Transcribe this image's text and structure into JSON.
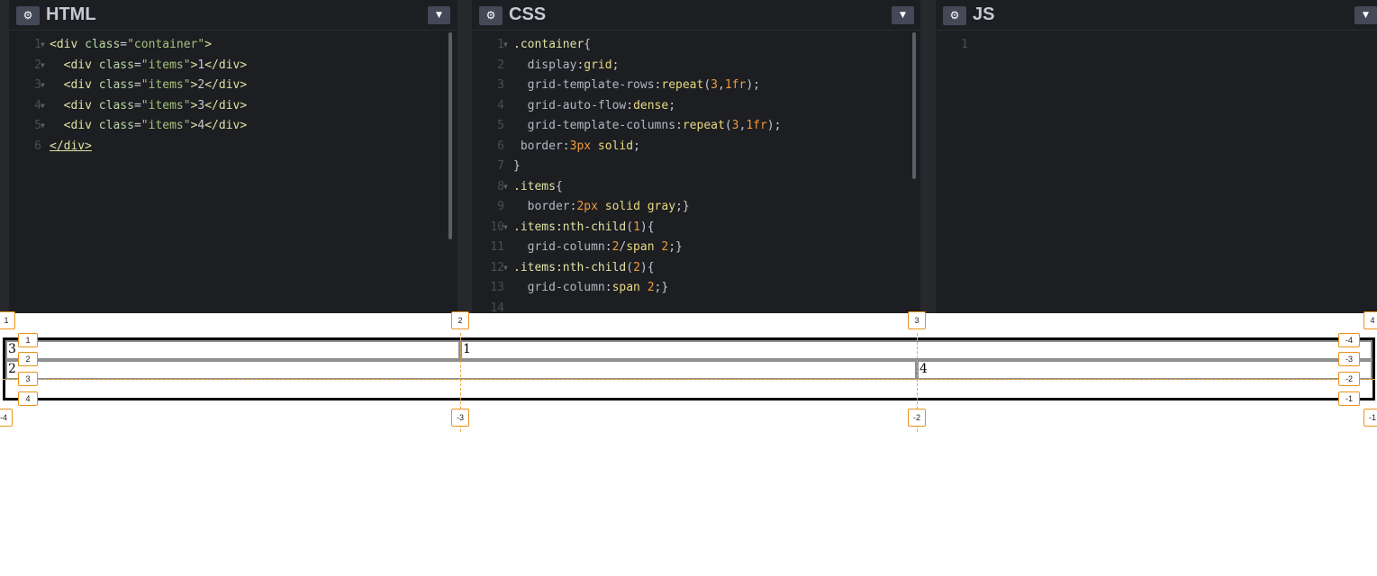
{
  "panes": {
    "html": {
      "title": "HTML",
      "lines": [
        {
          "n": "1",
          "fold": true,
          "tokens": [
            [
              "tag",
              "<div"
            ],
            [
              "attr",
              " class"
            ],
            [
              "punct",
              "="
            ],
            [
              "str",
              "\"container\""
            ],
            [
              "tag",
              ">"
            ]
          ]
        },
        {
          "n": "2",
          "fold": true,
          "tokens": [
            [
              "punct",
              "  "
            ],
            [
              "tag",
              "<div"
            ],
            [
              "attr",
              " class"
            ],
            [
              "punct",
              "="
            ],
            [
              "str",
              "\"items\""
            ],
            [
              "tag",
              ">"
            ],
            [
              "punct",
              "1"
            ],
            [
              "tag",
              "</div>"
            ]
          ]
        },
        {
          "n": "3",
          "fold": true,
          "tokens": [
            [
              "punct",
              "  "
            ],
            [
              "tag",
              "<div"
            ],
            [
              "attr",
              " class"
            ],
            [
              "punct",
              "="
            ],
            [
              "str",
              "\"items\""
            ],
            [
              "tag",
              ">"
            ],
            [
              "punct",
              "2"
            ],
            [
              "tag",
              "</div>"
            ]
          ]
        },
        {
          "n": "4",
          "fold": true,
          "tokens": [
            [
              "punct",
              "  "
            ],
            [
              "tag",
              "<div"
            ],
            [
              "attr",
              " class"
            ],
            [
              "punct",
              "="
            ],
            [
              "str",
              "\"items\""
            ],
            [
              "tag",
              ">"
            ],
            [
              "punct",
              "3"
            ],
            [
              "tag",
              "</div>"
            ]
          ]
        },
        {
          "n": "5",
          "fold": true,
          "tokens": [
            [
              "punct",
              "  "
            ],
            [
              "tag",
              "<div"
            ],
            [
              "attr",
              " class"
            ],
            [
              "punct",
              "="
            ],
            [
              "str",
              "\"items\""
            ],
            [
              "tag",
              ">"
            ],
            [
              "punct",
              "4"
            ],
            [
              "tag",
              "</div>"
            ]
          ]
        },
        {
          "n": "6",
          "fold": false,
          "tokens": [
            [
              "close",
              "</div>"
            ]
          ]
        }
      ]
    },
    "css": {
      "title": "CSS",
      "lines": [
        {
          "n": "1",
          "fold": true,
          "tokens": [
            [
              "sel",
              ".container"
            ],
            [
              "punct",
              "{"
            ]
          ]
        },
        {
          "n": "2",
          "fold": false,
          "tokens": [
            [
              "punct",
              "  "
            ],
            [
              "prop",
              "display"
            ],
            [
              "punct",
              ":"
            ],
            [
              "kw",
              "grid"
            ],
            [
              "punct",
              ";"
            ]
          ]
        },
        {
          "n": "3",
          "fold": false,
          "tokens": [
            [
              "punct",
              "  "
            ],
            [
              "prop",
              "grid-template-rows"
            ],
            [
              "punct",
              ":"
            ],
            [
              "fn",
              "repeat"
            ],
            [
              "punct",
              "("
            ],
            [
              "num",
              "3"
            ],
            [
              "punct",
              ","
            ],
            [
              "num",
              "1fr"
            ],
            [
              "punct",
              ");"
            ]
          ]
        },
        {
          "n": "4",
          "fold": false,
          "tokens": [
            [
              "punct",
              "  "
            ],
            [
              "prop",
              "grid-auto-flow"
            ],
            [
              "punct",
              ":"
            ],
            [
              "kw",
              "dense"
            ],
            [
              "punct",
              ";"
            ]
          ]
        },
        {
          "n": "5",
          "fold": false,
          "tokens": [
            [
              "punct",
              "  "
            ],
            [
              "prop",
              "grid-template-columns"
            ],
            [
              "punct",
              ":"
            ],
            [
              "fn",
              "repeat"
            ],
            [
              "punct",
              "("
            ],
            [
              "num",
              "3"
            ],
            [
              "punct",
              ","
            ],
            [
              "num",
              "1fr"
            ],
            [
              "punct",
              ");"
            ]
          ]
        },
        {
          "n": "6",
          "fold": false,
          "tokens": [
            [
              "punct",
              " "
            ],
            [
              "prop",
              "border"
            ],
            [
              "punct",
              ":"
            ],
            [
              "num",
              "3px"
            ],
            [
              "kw",
              " solid"
            ],
            [
              "punct",
              ";"
            ]
          ]
        },
        {
          "n": "7",
          "fold": false,
          "tokens": [
            [
              "punct",
              "}"
            ]
          ]
        },
        {
          "n": "8",
          "fold": true,
          "tokens": [
            [
              "sel",
              ".items"
            ],
            [
              "punct",
              "{"
            ]
          ]
        },
        {
          "n": "9",
          "fold": false,
          "tokens": [
            [
              "punct",
              "  "
            ],
            [
              "prop",
              "border"
            ],
            [
              "punct",
              ":"
            ],
            [
              "num",
              "2px"
            ],
            [
              "kw",
              " solid gray"
            ],
            [
              "punct",
              ";}"
            ]
          ]
        },
        {
          "n": "10",
          "fold": true,
          "tokens": [
            [
              "sel",
              ".items:nth-child"
            ],
            [
              "punct",
              "("
            ],
            [
              "num",
              "1"
            ],
            [
              "punct",
              ")"
            ],
            [
              "punct",
              "{"
            ]
          ]
        },
        {
          "n": "11",
          "fold": false,
          "tokens": [
            [
              "punct",
              "  "
            ],
            [
              "prop",
              "grid-column"
            ],
            [
              "punct",
              ":"
            ],
            [
              "num",
              "2"
            ],
            [
              "punct",
              "/"
            ],
            [
              "kw",
              "span "
            ],
            [
              "num",
              "2"
            ],
            [
              "punct",
              ";}"
            ]
          ]
        },
        {
          "n": "12",
          "fold": true,
          "tokens": [
            [
              "sel",
              ".items:nth-child"
            ],
            [
              "punct",
              "("
            ],
            [
              "num",
              "2"
            ],
            [
              "punct",
              ")"
            ],
            [
              "punct",
              "{"
            ]
          ]
        },
        {
          "n": "13",
          "fold": false,
          "tokens": [
            [
              "punct",
              "  "
            ],
            [
              "prop",
              "grid-column"
            ],
            [
              "punct",
              ":"
            ],
            [
              "kw",
              "span "
            ],
            [
              "num",
              "2"
            ],
            [
              "punct",
              ";}"
            ]
          ]
        },
        {
          "n": "14",
          "fold": false,
          "tokens": []
        }
      ]
    },
    "js": {
      "title": "JS",
      "lines": [
        {
          "n": "1",
          "fold": false,
          "tokens": []
        }
      ]
    }
  },
  "icons": {
    "settings": "gear-icon",
    "menu": "chevron-down-icon"
  },
  "result": {
    "items": [
      "1",
      "2",
      "3",
      "4"
    ],
    "column_badges_top": [
      "1",
      "2",
      "3",
      "4"
    ],
    "column_badges_bottom": [
      "-4",
      "-3",
      "-2",
      "-1"
    ],
    "row_badges_left": [
      "1",
      "2",
      "3",
      "4"
    ],
    "row_badges_right": [
      "-4",
      "-3",
      "-2",
      "-1"
    ]
  },
  "colors": {
    "editor_bg": "#1d1e22",
    "gutter_bg": "#27282c",
    "grid_line_accent": "#f0a63c",
    "item_border": "#8e8e8e"
  }
}
